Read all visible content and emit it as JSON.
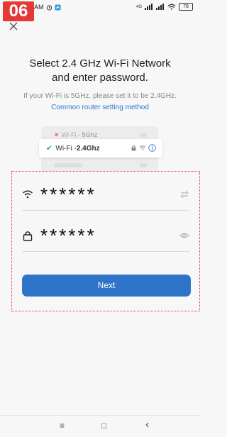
{
  "status_bar": {
    "badge": "06",
    "time": "AM",
    "battery": "78",
    "signal_label": "4G"
  },
  "header": {
    "title": "Select 2.4 GHz Wi-Fi Network\nand enter password.",
    "subtitle": "If your Wi-Fi is 5GHz, please set it to be 2.4GHz.",
    "link": "Common router setting method"
  },
  "illustration": {
    "row_5ghz_prefix": "Wi-Fi - ",
    "row_5ghz_band": "5Ghz",
    "row_24_prefix": "Wi-Fi - ",
    "row_24_band": "2.4Ghz"
  },
  "form": {
    "ssid_value": "******",
    "password_value": "******",
    "next_label": "Next"
  },
  "navbar": {
    "menu": "≡",
    "home": "□",
    "back": "‹"
  },
  "colors": {
    "accent": "#2e74c9",
    "badge": "#e53935",
    "check": "#27a844"
  }
}
